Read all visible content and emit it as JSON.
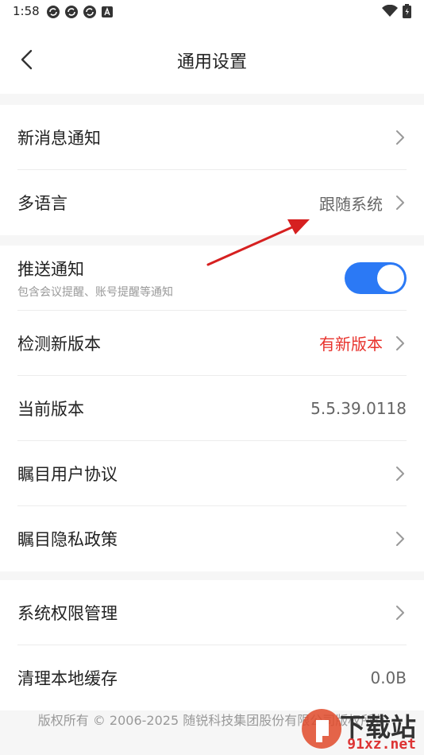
{
  "status_bar": {
    "time": "1:58",
    "left_icons": [
      "sync-icon",
      "sync-icon",
      "sync-icon",
      "a-icon"
    ],
    "right_icons": [
      "wifi-icon",
      "battery-icon"
    ]
  },
  "header": {
    "title": "通用设置",
    "back_icon": "chevron-left-icon"
  },
  "groups": {
    "g1": {
      "new_message": {
        "label": "新消息通知"
      },
      "language": {
        "label": "多语言",
        "value": "跟随系统"
      }
    },
    "g2": {
      "push": {
        "label": "推送通知",
        "sublabel": "包含会议提醒、账号提醒等通知",
        "enabled": true
      },
      "check_version": {
        "label": "检测新版本",
        "value": "有新版本"
      },
      "current_version": {
        "label": "当前版本",
        "value": "5.5.39.0118"
      },
      "user_agreement": {
        "label": "瞩目用户协议"
      },
      "privacy": {
        "label": "瞩目隐私政策"
      }
    },
    "g3": {
      "permissions": {
        "label": "系统权限管理"
      },
      "cache": {
        "label": "清理本地缓存",
        "value": "0.0B"
      }
    }
  },
  "footer": {
    "copyright": "版权所有 © 2006-2025 随锐科技集团股份有限公司版权所有"
  },
  "watermark": {
    "line1": "下载站",
    "line2": "91xz.net"
  },
  "colors": {
    "accent_blue": "#2b79f5",
    "alert_red": "#e8332d",
    "annotation_arrow": "#d62020"
  }
}
